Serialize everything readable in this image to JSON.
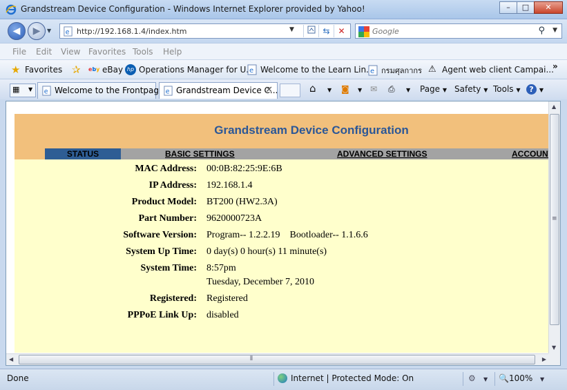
{
  "window": {
    "title": "Grandstream Device Configuration - Windows Internet Explorer provided by Yahoo!",
    "minimize": "–",
    "maximize": "□",
    "close": "✕"
  },
  "address": {
    "url": "http://192.168.1.4/index.htm",
    "search_placeholder": "Google"
  },
  "menu": [
    "File",
    "Edit",
    "View",
    "Favorites",
    "Tools",
    "Help"
  ],
  "favorites": {
    "label": "Favorites",
    "items": [
      "eBay",
      "Operations Manager for U...",
      "Welcome to the Learn Lin...",
      "กรมศุลกากร",
      "Agent web client Campai..."
    ],
    "overflow": "»"
  },
  "tabs": [
    {
      "label": "Welcome to the Frontpage"
    },
    {
      "label": "Grandstream Device C..."
    }
  ],
  "commands": {
    "page": "Page",
    "safety": "Safety",
    "tools": "Tools",
    "help": "?"
  },
  "device_page": {
    "banner_title": "Grandstream Device Configuration",
    "nav": {
      "status": "STATUS",
      "basic": "BASIC SETTINGS",
      "advanced": "ADVANCED SETTINGS",
      "account": "ACCOUNT"
    },
    "rows": [
      {
        "label": "MAC Address:",
        "value": "00:0B:82:25:9E:6B"
      },
      {
        "label": "IP Address:",
        "value": "192.168.1.4"
      },
      {
        "label": "Product Model:",
        "value": "BT200 (HW2.3A)"
      },
      {
        "label": "Part Number:",
        "value": "9620000723A"
      },
      {
        "label": "Software Version:",
        "value": "Program-- 1.2.2.19    Bootloader-- 1.1.6.6"
      },
      {
        "label": "System Up Time:",
        "value": "0 day(s) 0 hour(s) 11 minute(s)"
      },
      {
        "label": "System Time:",
        "value": "8:57pm",
        "value2": "Tuesday, December 7, 2010"
      },
      {
        "label": "Registered:",
        "value": "Registered"
      },
      {
        "label": "PPPoE Link Up:",
        "value": "disabled"
      }
    ]
  },
  "statusbar": {
    "text": "Done",
    "zone": "Internet | Protected Mode: On",
    "zoom": "100%"
  },
  "colors": {
    "banner": "#f2c07c",
    "page_bg": "#ffffcc",
    "title_blue": "#2b5797",
    "status_tab": "#2e5d94",
    "nav_gray": "#a3a3a3"
  }
}
